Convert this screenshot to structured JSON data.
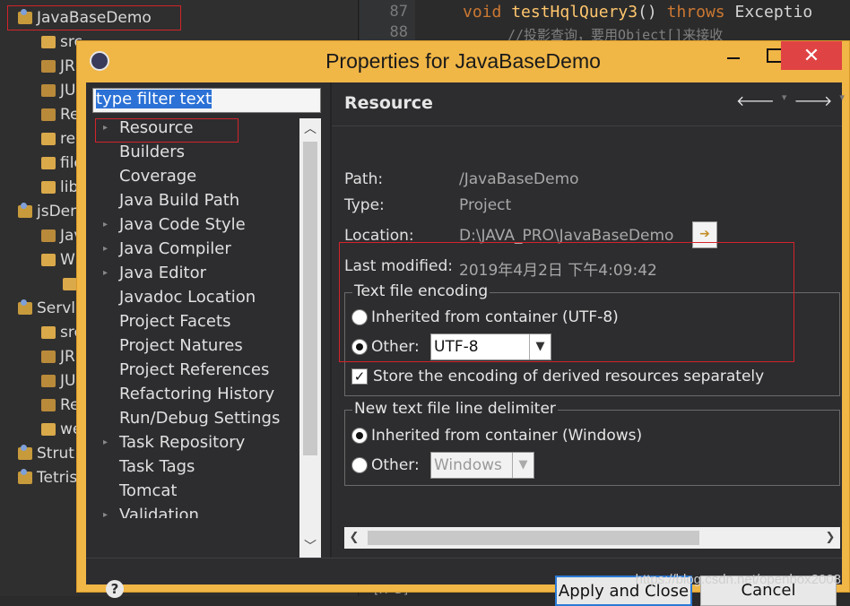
{
  "explorer": {
    "root_label": "JavaBaseDemo",
    "items": [
      {
        "label": "src"
      },
      {
        "label": "JR"
      },
      {
        "label": "JU"
      },
      {
        "label": "Re"
      },
      {
        "label": "res"
      },
      {
        "label": "file"
      },
      {
        "label": "lib"
      },
      {
        "label": "jsDem"
      },
      {
        "label": "Jav"
      },
      {
        "label": "W"
      },
      {
        "label": "Servle"
      },
      {
        "label": "src"
      },
      {
        "label": "JR"
      },
      {
        "label": "JU"
      },
      {
        "label": "Re"
      },
      {
        "label": "we"
      },
      {
        "label": "Strut"
      },
      {
        "label": "Tetris"
      }
    ]
  },
  "editor": {
    "line_numbers": [
      "87",
      "88"
    ],
    "line1_kw": "void",
    "line1_fn": "testHqlQuery3",
    "line1_paren": "()",
    "line1_throws": "throws",
    "line1_rest": "Exceptio",
    "line2_comment": "//投影查询，要用Object[]来接收",
    "bottom_text": "[A-B]"
  },
  "dialog": {
    "title": "Properties for JavaBaseDemo",
    "close_glyph": "✕",
    "filter_text": "type filter text",
    "nav_items": [
      "Resource",
      "Builders",
      "Coverage",
      "Java Build Path",
      "Java Code Style",
      "Java Compiler",
      "Java Editor",
      "Javadoc Location",
      "Project Facets",
      "Project Natures",
      "Project References",
      "Refactoring History",
      "Run/Debug Settings",
      "Task Repository",
      "Task Tags",
      "Tomcat",
      "Validation"
    ],
    "page_title": "Resource",
    "nav_back": "🡐",
    "nav_forward": "🡒",
    "nav_menu": "▾",
    "path_label": "Path:",
    "path_value": "/JavaBaseDemo",
    "type_label": "Type:",
    "type_value": "Project",
    "location_label": "Location:",
    "location_value": "D:\\JAVA_PRO\\JavaBaseDemo",
    "modified_label": "Last modified:",
    "modified_value": "2019年4月2日 下午4:09:42",
    "encoding_group": "Text file encoding",
    "enc_inherited": "Inherited from container (UTF-8)",
    "enc_other": "Other:",
    "enc_other_value": "UTF-8",
    "enc_store": "Store the encoding of derived resources separately",
    "delim_group": "New text file line delimiter",
    "delim_inherited": "Inherited from container (Windows)",
    "delim_other": "Other:",
    "delim_other_value": "Windows",
    "help": "?",
    "apply_close": "Apply and Close",
    "cancel": "Cancel"
  },
  "watermark": "https://blog.csdn.net/openbox2008",
  "colors": {
    "dialog_frame": "#f0b646",
    "dialog_body": "#2d2d30",
    "highlight_box": "#d3242a",
    "close_button": "#e04343"
  }
}
